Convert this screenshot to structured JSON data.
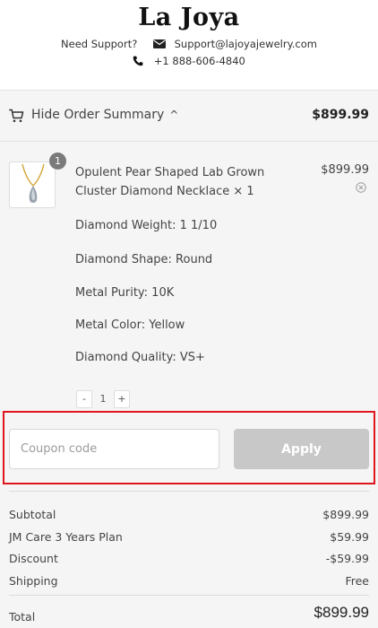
{
  "header": {
    "logo": "La Joya",
    "support_label": "Need Support?",
    "email": "Support@lajoyajewelry.com",
    "phone": "+1 888-606-4840"
  },
  "summary": {
    "toggle_label": "Hide Order Summary",
    "total": "$899.99"
  },
  "item": {
    "quantity_badge": "1",
    "name": "Opulent Pear Shaped Lab Grown Cluster Diamond Necklace × 1",
    "price": "$899.99",
    "attributes": [
      "Diamond Weight: 1 1/10",
      "Diamond Shape: Round",
      "Metal Purity: 10K",
      "Metal Color: Yellow",
      "Diamond Quality: VS+"
    ],
    "stepper": {
      "minus": "-",
      "value": "1",
      "plus": "+"
    }
  },
  "coupon": {
    "placeholder": "Coupon code",
    "apply_label": "Apply"
  },
  "totals": {
    "rows": [
      {
        "label": "Subtotal",
        "value": "$899.99"
      },
      {
        "label": "JM Care 3 Years Plan",
        "value": "$59.99"
      },
      {
        "label": "Discount",
        "value": "-$59.99"
      },
      {
        "label": "Shipping",
        "value": "Free"
      }
    ],
    "total_label": "Total",
    "total_value": "$899.99"
  },
  "colors": {
    "highlight_border": "#e0161e",
    "apply_disabled": "#c8c8c8",
    "summary_bg": "#f5f5f5"
  }
}
